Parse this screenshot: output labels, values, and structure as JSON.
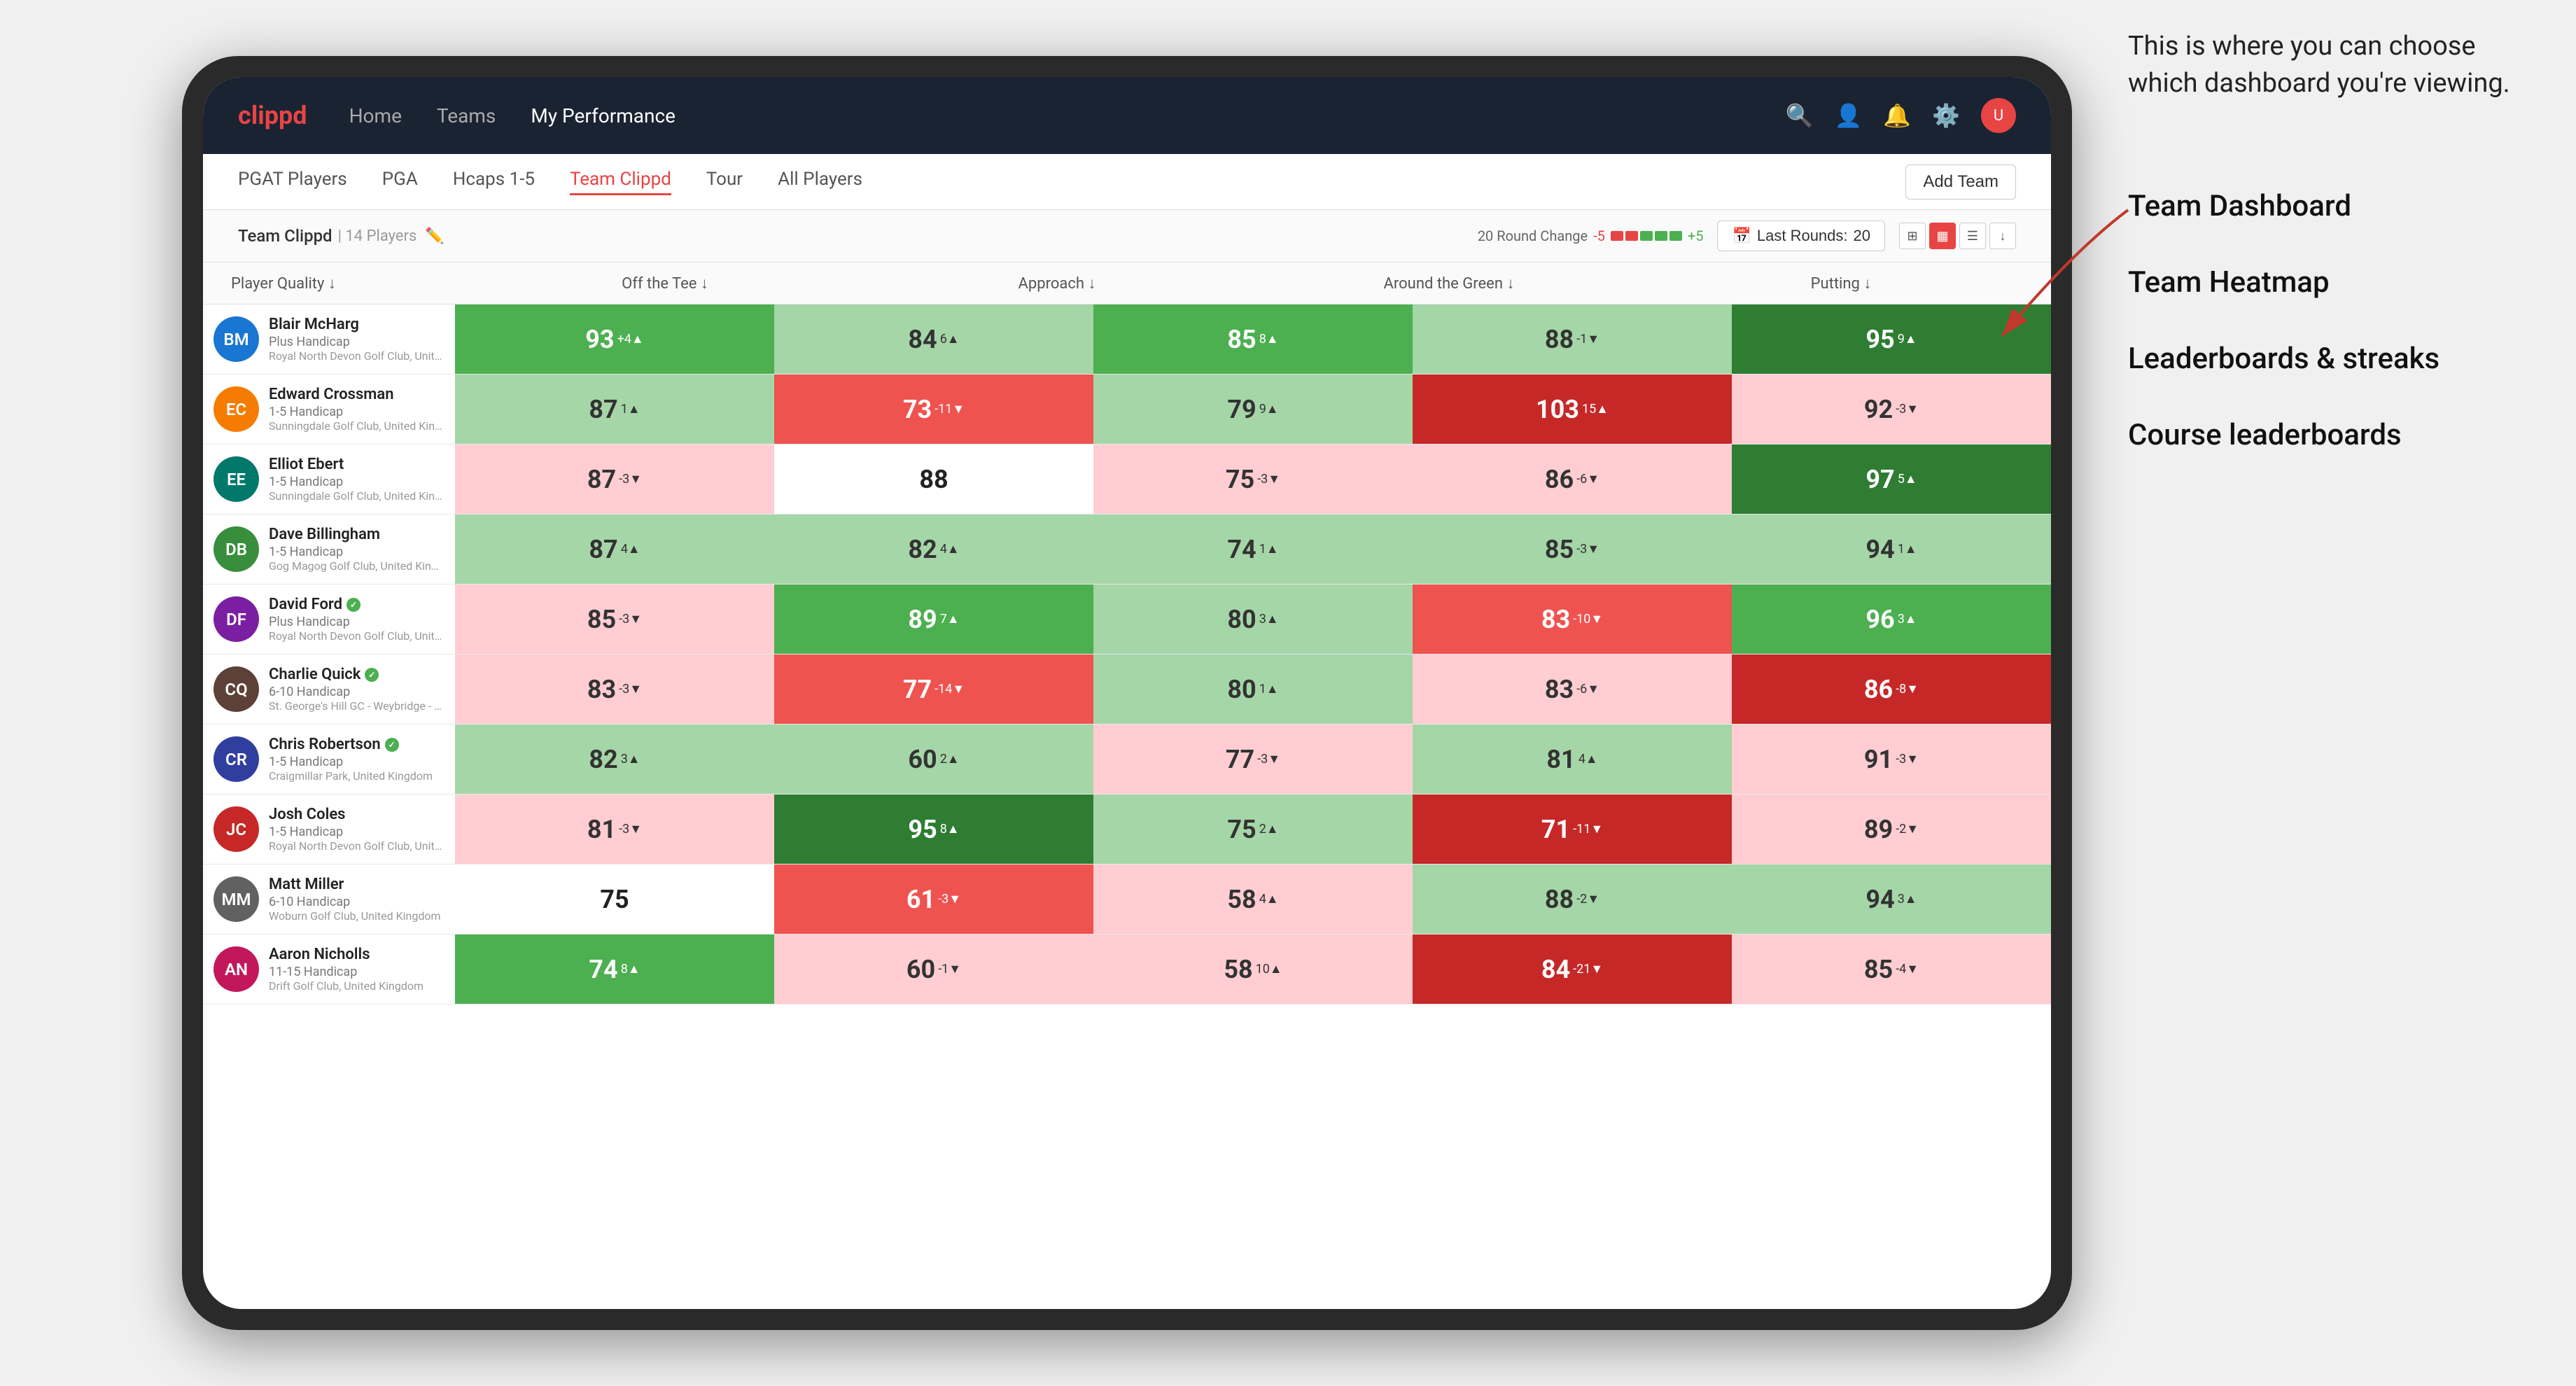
{
  "annotation": {
    "text": "This is where you can choose which dashboard you're viewing.",
    "options": [
      "Team Dashboard",
      "Team Heatmap",
      "Leaderboards & streaks",
      "Course leaderboards"
    ]
  },
  "nav": {
    "logo": "clippd",
    "links": [
      "Home",
      "Teams",
      "My Performance"
    ],
    "active_link": "My Performance"
  },
  "sub_nav": {
    "links": [
      "PGAT Players",
      "PGA",
      "Hcaps 1-5",
      "Team Clippd",
      "Tour",
      "All Players"
    ],
    "active_link": "Team Clippd",
    "add_team_label": "Add Team"
  },
  "team_header": {
    "name": "Team Clippd",
    "count": "14 Players",
    "round_change_label": "20 Round Change",
    "round_change_neg": "-5",
    "round_change_pos": "+5",
    "last_rounds_label": "Last Rounds:",
    "last_rounds_value": "20"
  },
  "table": {
    "columns": [
      "Player Quality ↓",
      "Off the Tee ↓",
      "Approach ↓",
      "Around the Green ↓",
      "Putting ↓"
    ],
    "rows": [
      {
        "name": "Blair McHarg",
        "handicap": "Plus Handicap",
        "club": "Royal North Devon Golf Club, United Kingdom",
        "avatar_initials": "BM",
        "avatar_color": "av-blue",
        "metrics": [
          {
            "value": 93,
            "change": "+4",
            "dir": "up",
            "color": "cell-green-mid"
          },
          {
            "value": 84,
            "change": "6",
            "dir": "up",
            "color": "cell-green-light"
          },
          {
            "value": 85,
            "change": "8",
            "dir": "up",
            "color": "cell-green-mid"
          },
          {
            "value": 88,
            "change": "-1",
            "dir": "down",
            "color": "cell-green-light"
          },
          {
            "value": 95,
            "change": "9",
            "dir": "up",
            "color": "cell-green-strong"
          }
        ]
      },
      {
        "name": "Edward Crossman",
        "handicap": "1-5 Handicap",
        "club": "Sunningdale Golf Club, United Kingdom",
        "avatar_initials": "EC",
        "avatar_color": "av-orange",
        "metrics": [
          {
            "value": 87,
            "change": "1",
            "dir": "up",
            "color": "cell-green-light"
          },
          {
            "value": 73,
            "change": "-11",
            "dir": "down",
            "color": "cell-red-mid"
          },
          {
            "value": 79,
            "change": "9",
            "dir": "up",
            "color": "cell-green-light"
          },
          {
            "value": 103,
            "change": "15",
            "dir": "up",
            "color": "cell-red-strong"
          },
          {
            "value": 92,
            "change": "-3",
            "dir": "down",
            "color": "cell-red-light"
          }
        ]
      },
      {
        "name": "Elliot Ebert",
        "handicap": "1-5 Handicap",
        "club": "Sunningdale Golf Club, United Kingdom",
        "avatar_initials": "EE",
        "avatar_color": "av-teal",
        "metrics": [
          {
            "value": 87,
            "change": "-3",
            "dir": "down",
            "color": "cell-red-light"
          },
          {
            "value": 88,
            "change": "",
            "dir": "",
            "color": "cell-white"
          },
          {
            "value": 75,
            "change": "-3",
            "dir": "down",
            "color": "cell-red-light"
          },
          {
            "value": 86,
            "change": "-6",
            "dir": "down",
            "color": "cell-red-light"
          },
          {
            "value": 97,
            "change": "5",
            "dir": "up",
            "color": "cell-green-strong"
          }
        ]
      },
      {
        "name": "Dave Billingham",
        "handicap": "1-5 Handicap",
        "club": "Gog Magog Golf Club, United Kingdom",
        "avatar_initials": "DB",
        "avatar_color": "av-green",
        "metrics": [
          {
            "value": 87,
            "change": "4",
            "dir": "up",
            "color": "cell-green-light"
          },
          {
            "value": 82,
            "change": "4",
            "dir": "up",
            "color": "cell-green-light"
          },
          {
            "value": 74,
            "change": "1",
            "dir": "up",
            "color": "cell-green-light"
          },
          {
            "value": 85,
            "change": "-3",
            "dir": "down",
            "color": "cell-green-light"
          },
          {
            "value": 94,
            "change": "1",
            "dir": "up",
            "color": "cell-green-light"
          }
        ]
      },
      {
        "name": "David Ford",
        "handicap": "Plus Handicap",
        "club": "Royal North Devon Golf Club, United Kingdom",
        "avatar_initials": "DF",
        "avatar_color": "av-purple",
        "verified": true,
        "metrics": [
          {
            "value": 85,
            "change": "-3",
            "dir": "down",
            "color": "cell-red-light"
          },
          {
            "value": 89,
            "change": "7",
            "dir": "up",
            "color": "cell-green-mid"
          },
          {
            "value": 80,
            "change": "3",
            "dir": "up",
            "color": "cell-green-light"
          },
          {
            "value": 83,
            "change": "-10",
            "dir": "down",
            "color": "cell-red-mid"
          },
          {
            "value": 96,
            "change": "3",
            "dir": "up",
            "color": "cell-green-mid"
          }
        ]
      },
      {
        "name": "Charlie Quick",
        "handicap": "6-10 Handicap",
        "club": "St. George's Hill GC - Weybridge - Surrey, Uni...",
        "avatar_initials": "CQ",
        "avatar_color": "av-brown",
        "verified": true,
        "metrics": [
          {
            "value": 83,
            "change": "-3",
            "dir": "down",
            "color": "cell-red-light"
          },
          {
            "value": 77,
            "change": "-14",
            "dir": "down",
            "color": "cell-red-mid"
          },
          {
            "value": 80,
            "change": "1",
            "dir": "up",
            "color": "cell-green-light"
          },
          {
            "value": 83,
            "change": "-6",
            "dir": "down",
            "color": "cell-red-light"
          },
          {
            "value": 86,
            "change": "-8",
            "dir": "down",
            "color": "cell-red-strong"
          }
        ]
      },
      {
        "name": "Chris Robertson",
        "handicap": "1-5 Handicap",
        "club": "Craigmillar Park, United Kingdom",
        "avatar_initials": "CR",
        "avatar_color": "av-indigo",
        "verified": true,
        "metrics": [
          {
            "value": 82,
            "change": "3",
            "dir": "up",
            "color": "cell-green-light"
          },
          {
            "value": 60,
            "change": "2",
            "dir": "up",
            "color": "cell-green-light"
          },
          {
            "value": 77,
            "change": "-3",
            "dir": "down",
            "color": "cell-red-light"
          },
          {
            "value": 81,
            "change": "4",
            "dir": "up",
            "color": "cell-green-light"
          },
          {
            "value": 91,
            "change": "-3",
            "dir": "down",
            "color": "cell-red-light"
          }
        ]
      },
      {
        "name": "Josh Coles",
        "handicap": "1-5 Handicap",
        "club": "Royal North Devon Golf Club, United Kingdom",
        "avatar_initials": "JC",
        "avatar_color": "av-red",
        "metrics": [
          {
            "value": 81,
            "change": "-3",
            "dir": "down",
            "color": "cell-red-light"
          },
          {
            "value": 95,
            "change": "8",
            "dir": "up",
            "color": "cell-green-strong"
          },
          {
            "value": 75,
            "change": "2",
            "dir": "up",
            "color": "cell-green-light"
          },
          {
            "value": 71,
            "change": "-11",
            "dir": "down",
            "color": "cell-red-strong"
          },
          {
            "value": 89,
            "change": "-2",
            "dir": "down",
            "color": "cell-red-light"
          }
        ]
      },
      {
        "name": "Matt Miller",
        "handicap": "6-10 Handicap",
        "club": "Woburn Golf Club, United Kingdom",
        "avatar_initials": "MM",
        "avatar_color": "av-gray",
        "metrics": [
          {
            "value": 75,
            "change": "",
            "dir": "",
            "color": "cell-white"
          },
          {
            "value": 61,
            "change": "-3",
            "dir": "down",
            "color": "cell-red-mid"
          },
          {
            "value": 58,
            "change": "4",
            "dir": "up",
            "color": "cell-red-light"
          },
          {
            "value": 88,
            "change": "-2",
            "dir": "down",
            "color": "cell-green-light"
          },
          {
            "value": 94,
            "change": "3",
            "dir": "up",
            "color": "cell-green-light"
          }
        ]
      },
      {
        "name": "Aaron Nicholls",
        "handicap": "11-15 Handicap",
        "club": "Drift Golf Club, United Kingdom",
        "avatar_initials": "AN",
        "avatar_color": "av-pink",
        "metrics": [
          {
            "value": 74,
            "change": "8",
            "dir": "up",
            "color": "cell-green-mid"
          },
          {
            "value": 60,
            "change": "-1",
            "dir": "down",
            "color": "cell-red-light"
          },
          {
            "value": 58,
            "change": "10",
            "dir": "up",
            "color": "cell-red-light"
          },
          {
            "value": 84,
            "change": "-21",
            "dir": "down",
            "color": "cell-red-strong"
          },
          {
            "value": 85,
            "change": "-4",
            "dir": "down",
            "color": "cell-red-light"
          }
        ]
      }
    ]
  }
}
